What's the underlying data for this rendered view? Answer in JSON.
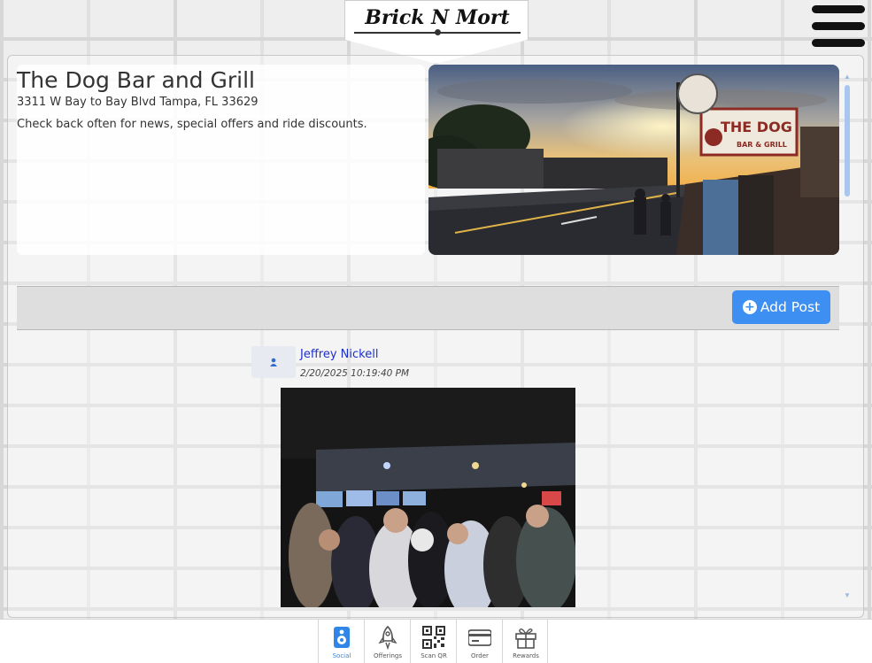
{
  "app": {
    "logo_text": "Brick N Mort"
  },
  "venue": {
    "name": "The Dog Bar and Grill",
    "address": "3311 W Bay to Bay Blvd Tampa, FL 33629",
    "note": "Check back often for news, special offers and ride discounts."
  },
  "toolbar": {
    "add_post_label": "Add Post"
  },
  "post": {
    "author": "Jeffrey Nickell",
    "timestamp": "2/20/2025 10:19:40 PM"
  },
  "nav": {
    "items": [
      {
        "label": "Social",
        "icon": "speaker-icon",
        "active": true
      },
      {
        "label": "Offerings",
        "icon": "rocket-icon",
        "active": false
      },
      {
        "label": "Scan QR",
        "icon": "qr-code-icon",
        "active": false
      },
      {
        "label": "Order",
        "icon": "credit-card-icon",
        "active": false
      },
      {
        "label": "Rewards",
        "icon": "gift-icon",
        "active": false
      }
    ]
  },
  "colors": {
    "accent": "#3d8ff2",
    "link": "#1c2fcb",
    "active_nav": "#2f86e8"
  }
}
